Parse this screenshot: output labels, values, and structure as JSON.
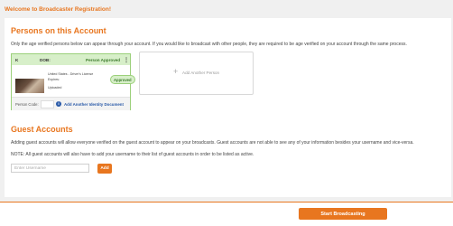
{
  "page": {
    "title": "Welcome to Broadcaster Registration!"
  },
  "persons": {
    "heading": "Persons on this Account",
    "description": "Only the age verified persons below can appear through your account. If you would like to broadcast with other people, they are required to be age verified on your account through the same process.",
    "card": {
      "name": "K",
      "dob_label": "DOB:",
      "status_header": "Person Approved",
      "doc_line1": "United States - Driver's License",
      "doc_line2": "Expires:",
      "doc_line3": "Uploaded",
      "badge": "Approved",
      "person_code_label": "Person Code:",
      "add_doc_label": "Add Another Identity Document"
    },
    "add_person_label": "Add Another Person"
  },
  "guests": {
    "heading": "Guest Accounts",
    "description": "Adding guest accounts will allow everyone verified on the guest account to appear on your broadcasts. Guest accounts are not able to see any of your information besides your username and vice-versa.",
    "note": "NOTE: All guest accounts will also have to add your username to their list of guest accounts in order to be listed as active.",
    "input_placeholder": "Enter Username",
    "add_button": "Add"
  },
  "footer": {
    "start_button": "Start Broadcasting"
  },
  "colors": {
    "accent": "#e8761f",
    "approved_bg": "#d7efc9",
    "approved_border": "#9bd07a",
    "link": "#2a5aa8"
  },
  "icons": {
    "menu": "kebab-menu-icon",
    "info": "info-icon",
    "add": "plus-icon"
  }
}
